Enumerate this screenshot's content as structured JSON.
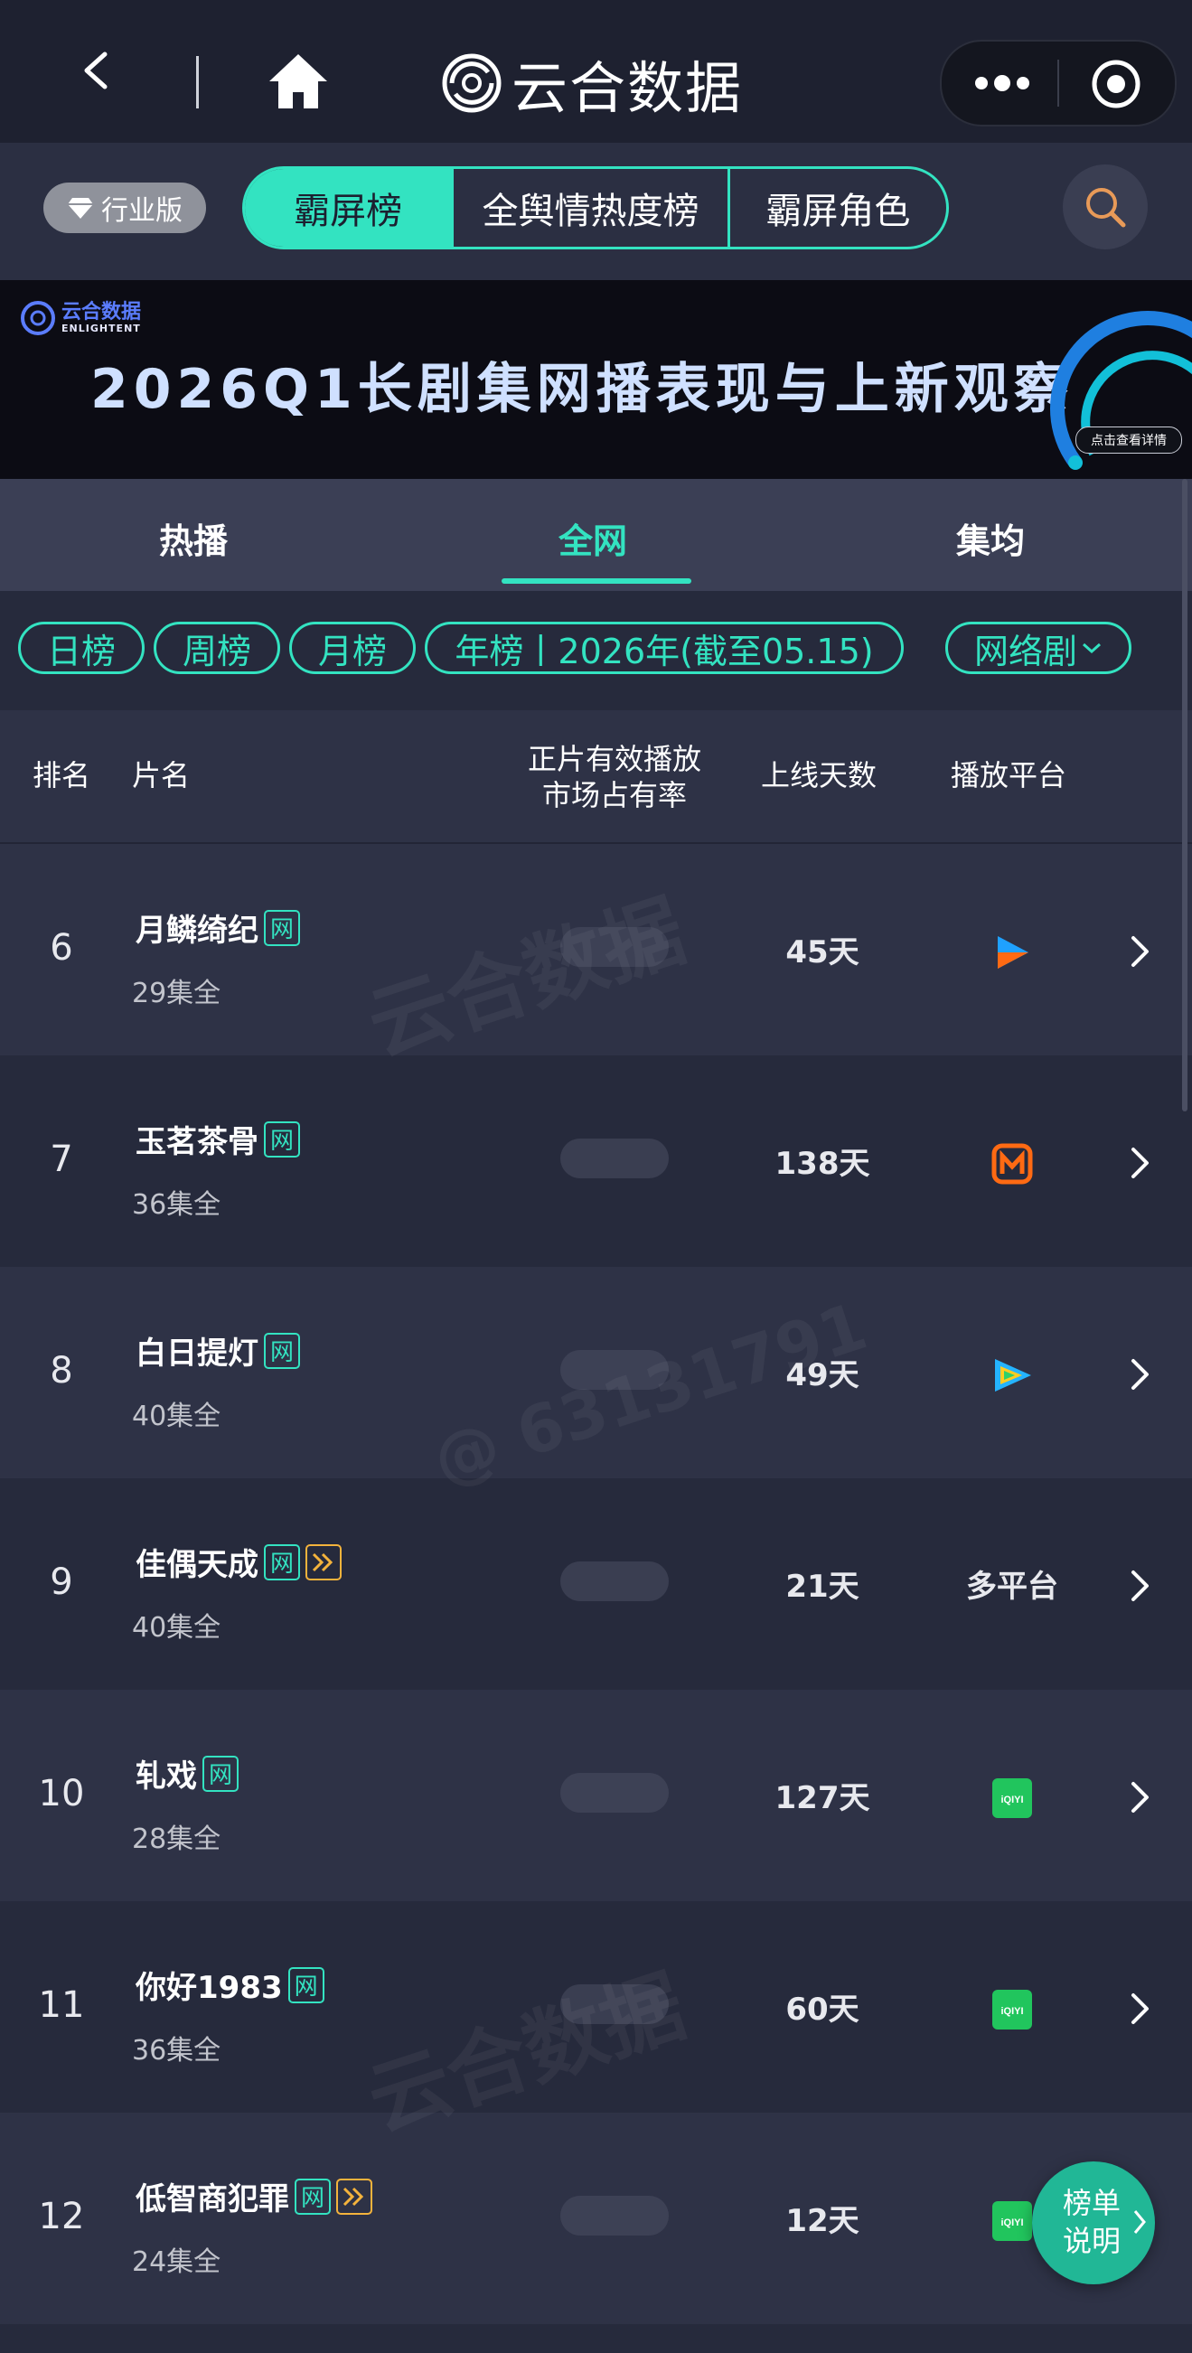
{
  "titlebar": {
    "brand": "云合数据",
    "back_icon": "chevron-left-icon",
    "home_icon": "home-icon",
    "more_icon": "more-dots-icon",
    "target_icon": "target-icon"
  },
  "filterbar": {
    "industry_label": "行业版",
    "segments": [
      "霸屏榜",
      "全舆情热度榜",
      "霸屏角色"
    ],
    "active_segment": "霸屏榜"
  },
  "banner": {
    "logo_cn": "云合数据",
    "logo_en": "ENLIGHTENT",
    "title": "2026Q1长剧集网播表现与上新观察",
    "button": "点击查看详情"
  },
  "tabs": [
    "热播",
    "全网",
    "集均"
  ],
  "active_tab": "全网",
  "periods": {
    "day": "日榜",
    "week": "周榜",
    "month": "月榜",
    "year": "年榜丨2026年(截至05.15)",
    "category": "网络剧"
  },
  "table": {
    "headers": {
      "rank": "排名",
      "title": "片名",
      "share_line1": "正片有效播放",
      "share_line2": "市场占有率",
      "days": "上线天数",
      "platform": "播放平台"
    },
    "tag_net": "网",
    "rows": [
      {
        "rank": "6",
        "title": "月鳞绮纪",
        "episodes": "29集全",
        "days": "45天",
        "platform": "youku",
        "platform_text": "",
        "fwd": false
      },
      {
        "rank": "7",
        "title": "玉茗茶骨",
        "episodes": "36集全",
        "days": "138天",
        "platform": "mgtv",
        "platform_text": "",
        "fwd": false
      },
      {
        "rank": "8",
        "title": "白日提灯",
        "episodes": "40集全",
        "days": "49天",
        "platform": "tencent",
        "platform_text": "",
        "fwd": false
      },
      {
        "rank": "9",
        "title": "佳偶天成",
        "episodes": "40集全",
        "days": "21天",
        "platform": "multi",
        "platform_text": "多平台",
        "fwd": true
      },
      {
        "rank": "10",
        "title": "轧戏",
        "episodes": "28集全",
        "days": "127天",
        "platform": "iqiyi",
        "platform_text": "",
        "fwd": false
      },
      {
        "rank": "11",
        "title": "你好1983",
        "episodes": "36集全",
        "days": "60天",
        "platform": "iqiyi",
        "platform_text": "",
        "fwd": false
      },
      {
        "rank": "12",
        "title": "低智商犯罪",
        "episodes": "24集全",
        "days": "12天",
        "platform": "iqiyi",
        "platform_text": "",
        "fwd": true
      }
    ]
  },
  "fab": {
    "line1": "榜单",
    "line2": "说明"
  },
  "watermark": {
    "brand_cn": "云合数据",
    "brand_en": "ENLIGHTENT",
    "user": "@ 63131791"
  },
  "colors": {
    "accent": "#33e3c1",
    "background": "#262a3c",
    "header_bar": "#1e2130",
    "fwd_tag": "#f4b33c",
    "iqiyi": "#21c55d",
    "mgtv": "#ff6a13"
  }
}
